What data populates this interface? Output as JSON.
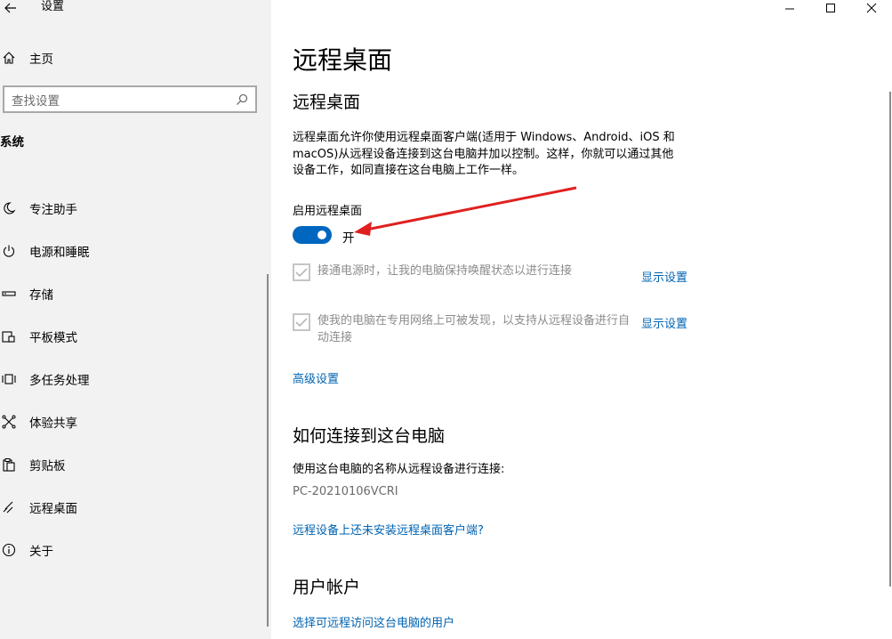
{
  "window": {
    "app_title": "设置"
  },
  "sidebar": {
    "home_label": "主页",
    "search_placeholder": "查找设置",
    "section_label": "系统",
    "items": [
      {
        "label": "专注助手",
        "icon": "moon-icon"
      },
      {
        "label": "电源和睡眠",
        "icon": "power-icon"
      },
      {
        "label": "存储",
        "icon": "storage-icon"
      },
      {
        "label": "平板模式",
        "icon": "tablet-icon"
      },
      {
        "label": "多任务处理",
        "icon": "multitask-icon"
      },
      {
        "label": "体验共享",
        "icon": "share-icon"
      },
      {
        "label": "剪贴板",
        "icon": "clipboard-icon"
      },
      {
        "label": "远程桌面",
        "icon": "remote-desktop-icon"
      },
      {
        "label": "关于",
        "icon": "info-icon"
      }
    ]
  },
  "main": {
    "page_title": "远程桌面",
    "section1_title": "远程桌面",
    "description": "远程桌面允许你使用远程桌面客户端(适用于 Windows、Android、iOS 和 macOS)从远程设备连接到这台电脑并加以控制。这样，你就可以通过其他设备工作，如同直接在这台电脑上工作一样。",
    "toggle_label": "启用远程桌面",
    "toggle_state": "开",
    "toggle_on": true,
    "option1_text": "接通电源时，让我的电脑保持唤醒状态以进行连接",
    "option1_link": "显示设置",
    "option2_text": "使我的电脑在专用网络上可被发现，以支持从远程设备进行自动连接",
    "option2_link": "显示设置",
    "advanced_link": "高级设置",
    "section2_title": "如何连接到这台电脑",
    "connect_text": "使用这台电脑的名称从远程设备进行连接:",
    "pc_name": "PC-20210106VCRI",
    "client_link": "远程设备上还未安装远程桌面客户端?",
    "section3_title": "用户帐户",
    "users_link": "选择可远程访问这台电脑的用户"
  },
  "colors": {
    "accent": "#0067c0",
    "link": "#0063b1",
    "annotation": "#e02020",
    "sidebar_bg": "#f2f2f2"
  }
}
